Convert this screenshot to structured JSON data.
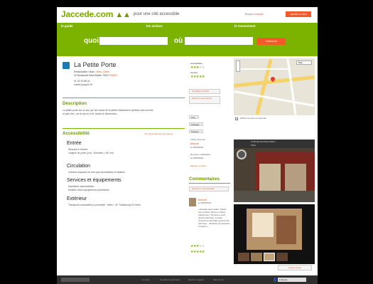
{
  "header": {
    "logo": "Jaccede.com",
    "tagline": "pour une cité accessible",
    "bonjour_prefix": "Bonjour",
    "user": "marcelc",
    "top_button": "Ajouter un lieu"
  },
  "nav": {
    "items": [
      {
        "label": "le guide"
      },
      {
        "label": "les actions"
      },
      {
        "label": "le mouvement"
      }
    ]
  },
  "search": {
    "quoi_label": "quoi",
    "ou_label": "où",
    "button": "Chercher"
  },
  "place": {
    "name": "La Petite Porte",
    "type_label": "Restauration / Bars :",
    "type_link": "Bars, Cafés",
    "address": "20 Boulevard Saint-Martin 75010",
    "city_link": "PARIS",
    "phone": "01 42 10 88 21",
    "hours": "ouvert jusqu'à 2h"
  },
  "description": {
    "heading": "Description",
    "text": "La petite porte est un bar, qui sert aussi de la petite restauration (tartines des bonnes et pas cher, ),et du jeu tu troll, durant le dimanches."
  },
  "accessibility": {
    "heading": "Accessibilité",
    "link": "En savoir plus sur les critères",
    "sections": [
      {
        "title": "Entrée",
        "lines": [
          "Ressaut à l'entrée",
          "Largeur de porte (cm) : Normale (> 80 cm)"
        ]
      },
      {
        "title": "Circulation",
        "lines": [
          "Certains espaces ne sont pas accessibles en fauteuil"
        ]
      },
      {
        "title": "Services et équipements",
        "lines": [
          "Sanitaires inaccessibles",
          "Mobilier et/ou équipements prioritaires"
        ]
      },
      {
        "title": "Extérieur",
        "lines": [
          "Transports accessibles à proximité : Metro : M° Strasbourg St Denis"
        ]
      }
    ]
  },
  "ratings": {
    "accessibility_label": "Accessibilité",
    "accessibility_value": 3,
    "accueil_label": "Accueil",
    "accueil_value": 5
  },
  "side_actions": {
    "complete": "Compléter la fiche",
    "favorite": "Ajouter à mes favoris",
    "like": "Like",
    "share": "Partager",
    "tweet": "Tweeter",
    "created_by_label": "Fiche créée par",
    "creator": "Marcel",
    "created_date": "le 25/06/2010",
    "modified_label": "Dernière modification",
    "modified_date": "le 25/06/2010",
    "report": "Signaler un abus"
  },
  "comments": {
    "heading": "Commentaires",
    "add_button": "Ajouter un commentaire",
    "author": "Marcel",
    "date": "le 25/06/2010",
    "text": "« Ressaut raisonnable. Toilette très inclusive. Bonne musique (parfois live). Terrasse a partir quand il fait beau, terrasse couverte en hiver/Mer quand il fait pas beau. ~Tartelette au saucisson excellent.»",
    "rating_access": 3,
    "rating_accueil": 5
  },
  "map": {
    "type_select": "Plan",
    "show_all": "afficher les lieux à proximité"
  },
  "streetview": {
    "address": "47 Boulevard Saint-Martin",
    "city": "Paris"
  },
  "photos": {
    "add_button": "Ajouter photo"
  },
  "footer": {
    "links": [
      "Contact",
      "Conditions générales",
      "Mentions légales",
      "Plan du site"
    ],
    "language": "Français"
  }
}
